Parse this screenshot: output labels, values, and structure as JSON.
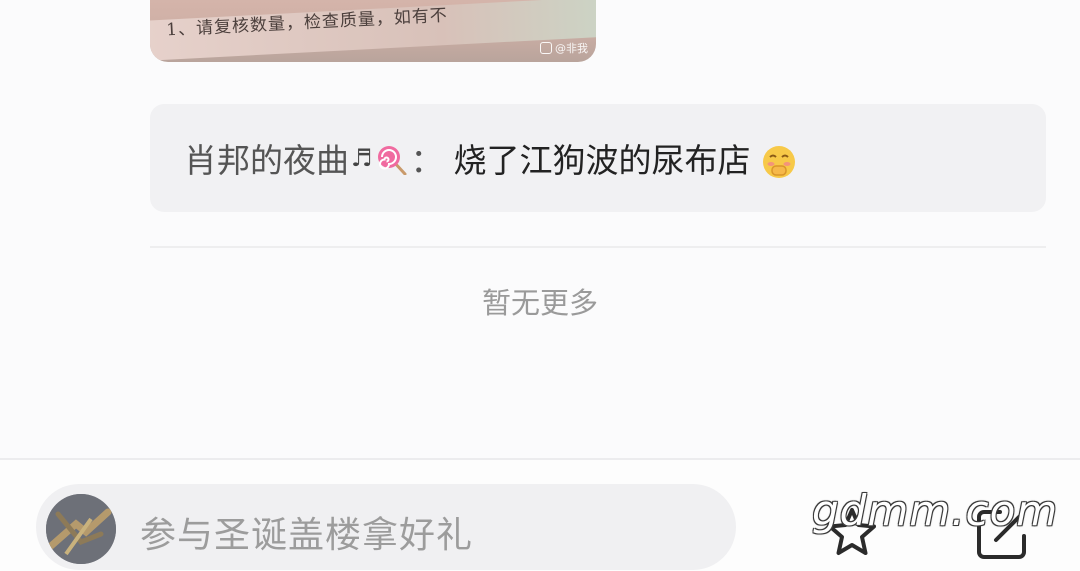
{
  "post_image": {
    "paper_text": "1、请复核数量，检查质量，如有不",
    "watermark": "@非我"
  },
  "comment": {
    "author": "肖邦的夜曲",
    "separator": "：",
    "text": "烧了江狗波的尿布店"
  },
  "footer_status": "暂无更多",
  "bottom_bar": {
    "input_placeholder": "参与圣诞盖楼拿好礼"
  },
  "site_watermark": "gdmm.com",
  "icons": {
    "comment": [
      "music-note-icon",
      "lollipop-icon",
      "shy-face-icon"
    ],
    "bottom_bar": [
      "star-icon",
      "edit-icon"
    ]
  }
}
